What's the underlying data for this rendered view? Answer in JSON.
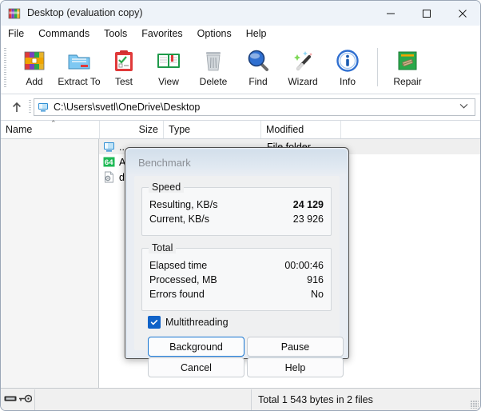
{
  "window": {
    "title": "Desktop (evaluation copy)",
    "icon": "winrar-books-icon",
    "controls": {
      "minimize": "–",
      "maximize": "□",
      "close": "✕"
    }
  },
  "menubar": {
    "items": [
      {
        "label": "File"
      },
      {
        "label": "Commands"
      },
      {
        "label": "Tools"
      },
      {
        "label": "Favorites"
      },
      {
        "label": "Options"
      },
      {
        "label": "Help"
      }
    ]
  },
  "toolbar": {
    "buttons": [
      {
        "label": "Add",
        "icon": "add-archive-icon"
      },
      {
        "label": "Extract To",
        "icon": "extract-folder-icon"
      },
      {
        "label": "Test",
        "icon": "test-clipboard-icon"
      },
      {
        "label": "View",
        "icon": "view-book-icon"
      },
      {
        "label": "Delete",
        "icon": "delete-trash-icon"
      },
      {
        "label": "Find",
        "icon": "find-magnifier-icon"
      },
      {
        "label": "Wizard",
        "icon": "wizard-wand-icon"
      },
      {
        "label": "Info",
        "icon": "info-circle-icon"
      },
      {
        "label": "Repair",
        "icon": "repair-icon"
      }
    ]
  },
  "address": {
    "up_icon": "arrow-up-icon",
    "folder_icon": "computer-icon",
    "path": "C:\\Users\\svetl\\OneDrive\\Desktop",
    "dropdown_icon": "chevron-down-icon"
  },
  "columns": [
    {
      "key": "name",
      "label": "Name",
      "sorted": true,
      "sort_icon": "⌃"
    },
    {
      "key": "size",
      "label": "Size"
    },
    {
      "key": "type",
      "label": "Type"
    },
    {
      "key": "modified",
      "label": "Modified"
    }
  ],
  "files": [
    {
      "name": "..",
      "size": "",
      "type": "File folder",
      "modified": "",
      "icon": "parent-folder-icon",
      "selected": true
    },
    {
      "name": "AIDA64 Enginee...",
      "size": "",
      "type": "",
      "modified": "",
      "icon": "aida64-icon",
      "selected": false
    },
    {
      "name": "desktop.ini",
      "size": "",
      "type": "",
      "modified": "",
      "icon": "ini-file-icon",
      "selected": false
    }
  ],
  "statusbar": {
    "left_icons": [
      "archive-icon",
      "key-icon"
    ],
    "total": "Total 1 543 bytes in 2 files"
  },
  "dialog": {
    "title": "Benchmark",
    "groups": [
      {
        "label": "Speed",
        "rows": [
          {
            "label": "Resulting, KB/s",
            "value": "24 129",
            "bold": true
          },
          {
            "label": "Current, KB/s",
            "value": "23 926",
            "bold": false
          }
        ]
      },
      {
        "label": "Total",
        "rows": [
          {
            "label": "Elapsed time",
            "value": "00:00:46",
            "bold": false
          },
          {
            "label": "Processed, MB",
            "value": "916",
            "bold": false
          },
          {
            "label": "Errors found",
            "value": "No",
            "bold": false
          }
        ]
      }
    ],
    "checkbox": {
      "label": "Multithreading",
      "checked": true
    },
    "buttons": [
      {
        "label": "Background",
        "default": true
      },
      {
        "label": "Pause",
        "default": false
      },
      {
        "label": "Cancel",
        "default": false
      },
      {
        "label": "Help",
        "default": false
      }
    ]
  },
  "colors": {
    "accent": "#1775d1",
    "checkbox": "#0f62c8",
    "titlebar": "#eef3f9",
    "dialog_bg": "#e9edf3"
  }
}
